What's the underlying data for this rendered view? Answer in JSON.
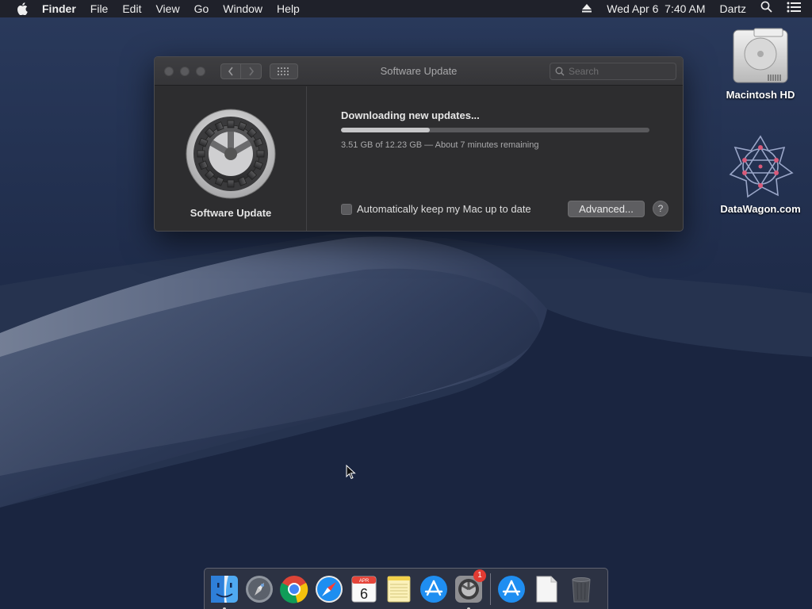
{
  "menubar": {
    "apple": "",
    "items": [
      "Finder",
      "File",
      "Edit",
      "View",
      "Go",
      "Window",
      "Help"
    ],
    "clock": "Wed Apr 6  7:40 AM",
    "user": "Dartz"
  },
  "desktop": {
    "icons": [
      {
        "label": "Macintosh HD",
        "icon": "hard-drive-icon"
      },
      {
        "label": "DataWagon.com",
        "icon": "datawagon-icon"
      }
    ]
  },
  "window": {
    "title": "Software Update",
    "search_placeholder": "Search",
    "pane_label": "Software Update",
    "status": "Downloading new updates...",
    "progress": 0.287,
    "progress_text": "3.51 GB of 12.23 GB — About 7 minutes remaining",
    "auto_update_label": "Automatically keep my Mac up to date",
    "auto_update_checked": false,
    "advanced_label": "Advanced...",
    "help_label": "?"
  },
  "dock": {
    "apps": [
      {
        "name": "Finder",
        "icon": "finder-icon",
        "running": true
      },
      {
        "name": "Launchpad",
        "icon": "launchpad-icon",
        "running": false
      },
      {
        "name": "Chrome",
        "icon": "chrome-icon",
        "running": false
      },
      {
        "name": "Safari",
        "icon": "safari-icon",
        "running": false
      },
      {
        "name": "Calendar",
        "icon": "calendar-icon",
        "running": false,
        "month": "APR",
        "day": "6"
      },
      {
        "name": "Notes",
        "icon": "notes-icon",
        "running": false
      },
      {
        "name": "App Store",
        "icon": "app-store-icon",
        "running": false
      },
      {
        "name": "System Preferences",
        "icon": "system-preferences-icon",
        "running": true,
        "badge": "1"
      }
    ],
    "others": [
      {
        "name": "Applications",
        "icon": "app-store-icon"
      },
      {
        "name": "Document",
        "icon": "document-icon"
      },
      {
        "name": "Trash",
        "icon": "trash-icon"
      }
    ]
  },
  "colors": {
    "accent": "#c6c6c8",
    "window_bg": "#2d2d2f",
    "badge": "#e23b33"
  }
}
